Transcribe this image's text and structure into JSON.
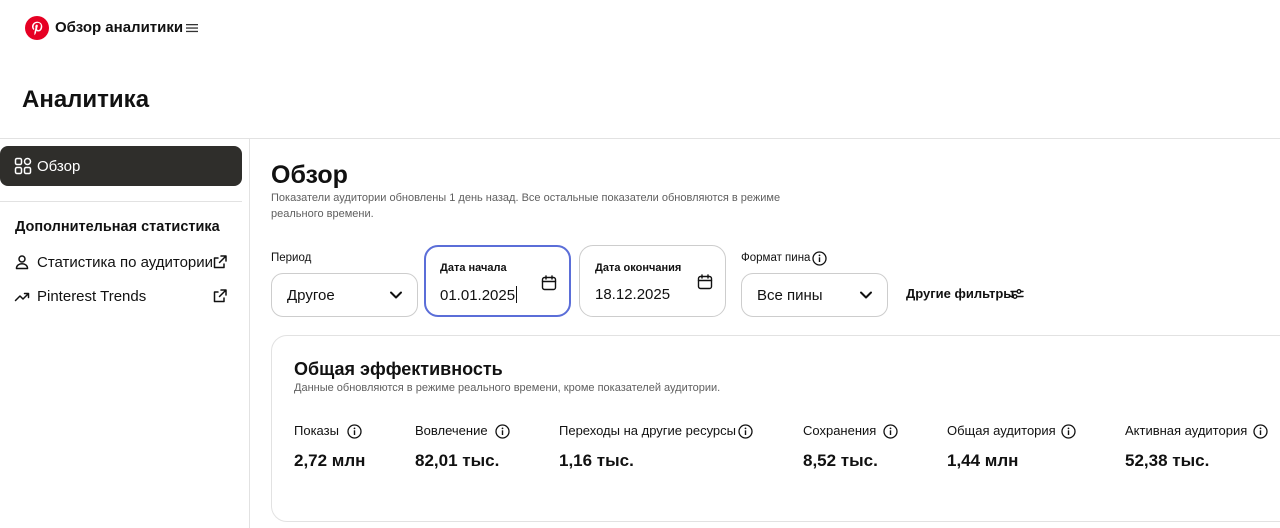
{
  "header": {
    "app_title": "Обзор аналитики",
    "brand_color": "#e60023",
    "menu_icon": "hamburger-icon"
  },
  "page": {
    "title": "Аналитика"
  },
  "sidebar": {
    "overview": {
      "label": "Обзор",
      "icon": "grid-icon",
      "active": true
    },
    "section_heading": "Дополнительная статистика",
    "links": [
      {
        "label": "Статистика по аудитории",
        "icon": "person-icon",
        "external": true
      },
      {
        "label": "Pinterest Trends",
        "icon": "trend-icon",
        "external": true
      }
    ]
  },
  "main": {
    "title": "Обзор",
    "subtitle": "Показатели аудитории обновлены 1 день назад. Все остальные показатели обновляются в режиме реального времени.",
    "filters": {
      "period": {
        "label": "Период",
        "value": "Другое"
      },
      "start_date": {
        "label": "Дата начала",
        "value": "01.01.2025"
      },
      "end_date": {
        "label": "Дата окончания",
        "value": "18.12.2025"
      },
      "pin_format": {
        "label": "Формат пина",
        "value": "Все пины"
      },
      "more_filters": "Другие фильтры",
      "active_border_color": "#5b6ed8"
    },
    "card": {
      "title": "Общая эффективность",
      "subtitle": "Данные обновляются в режиме реального времени, кроме показателей аудитории.",
      "metrics": [
        {
          "label": "Показы",
          "value": "2,72 млн"
        },
        {
          "label": "Вовлечение",
          "value": "82,01 тыс."
        },
        {
          "label": "Переходы на другие ресурсы",
          "value": "1,16 тыс."
        },
        {
          "label": "Сохранения",
          "value": "8,52 тыс."
        },
        {
          "label": "Общая аудитория",
          "value": "1,44 млн"
        },
        {
          "label": "Активная аудитория",
          "value": "52,38 тыс."
        }
      ]
    }
  }
}
